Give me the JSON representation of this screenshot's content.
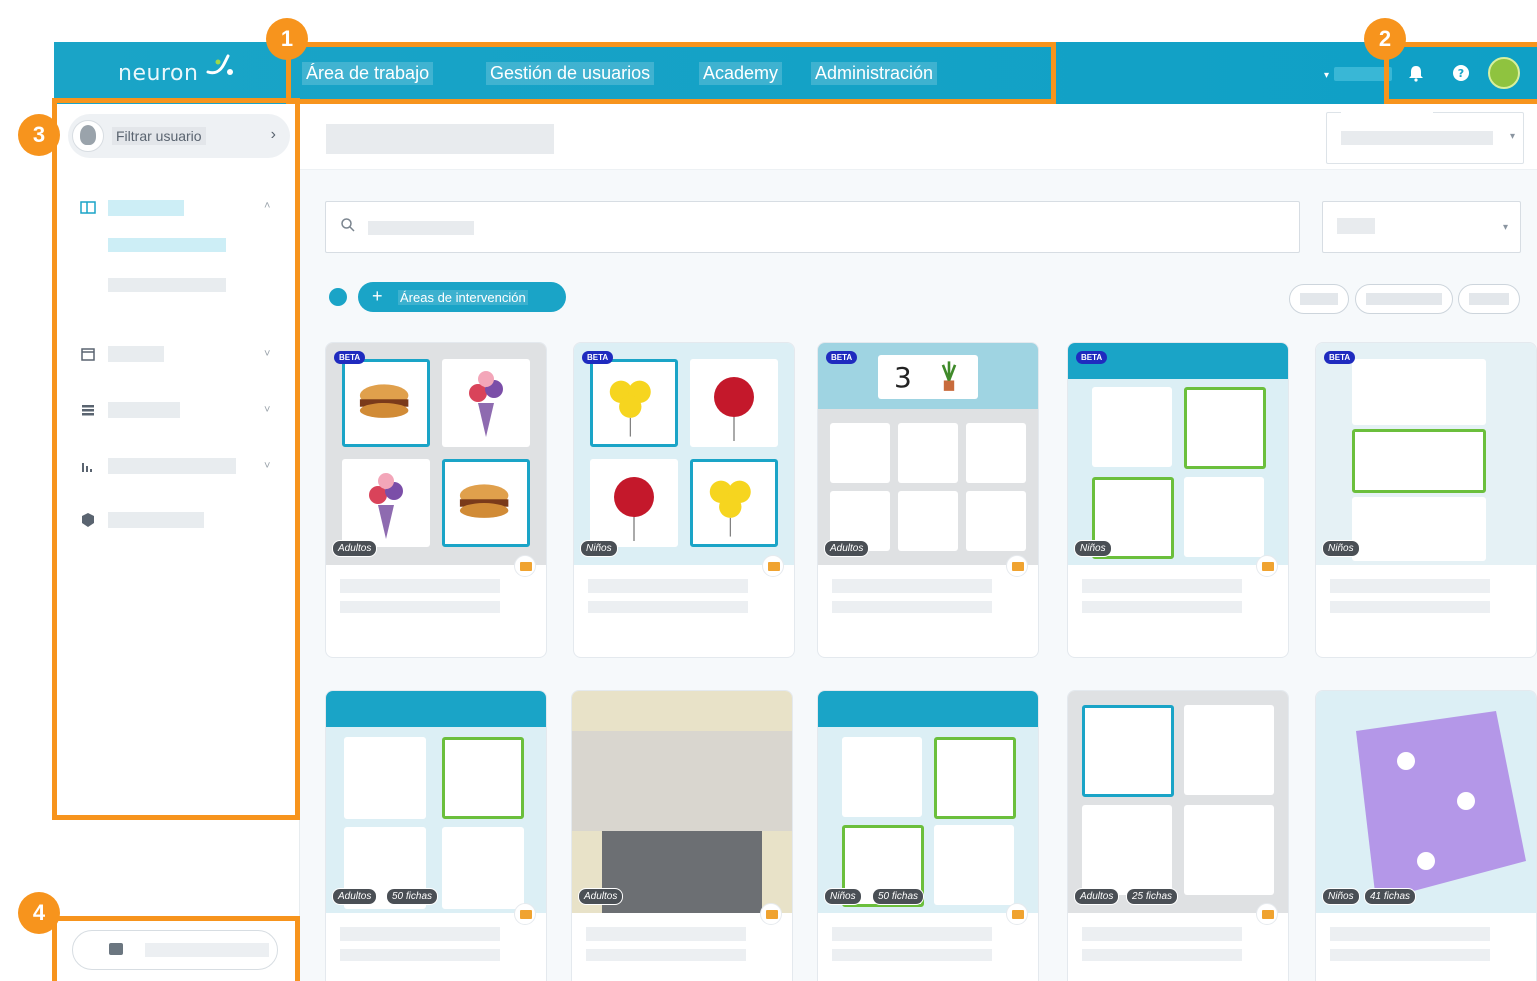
{
  "nav": {
    "items": [
      "Área de trabajo",
      "Gestión de usuarios",
      "Academy",
      "Administración"
    ]
  },
  "sidebar": {
    "user_filter_label": "Filtrar usuario"
  },
  "toolbar": {
    "areas_button": "Áreas de intervención"
  },
  "cards": [
    {
      "beta": "BETA",
      "tag": "Adultos",
      "count": ""
    },
    {
      "beta": "BETA",
      "tag": "Niños",
      "count": ""
    },
    {
      "beta": "BETA",
      "tag": "Adultos",
      "count": "",
      "number": "3"
    },
    {
      "beta": "BETA",
      "tag": "Niños",
      "count": ""
    },
    {
      "beta": "BETA",
      "tag": "Niños",
      "count": ""
    },
    {
      "beta": "",
      "tag": "Adultos",
      "count": "50 fichas"
    },
    {
      "beta": "",
      "tag": "Adultos",
      "count": ""
    },
    {
      "beta": "",
      "tag": "Niños",
      "count": "50 fichas"
    },
    {
      "beta": "",
      "tag": "Adultos",
      "count": "25 fichas"
    },
    {
      "beta": "",
      "tag": "Niños",
      "count": "41 fichas"
    }
  ],
  "badges": [
    "1",
    "2",
    "3",
    "4"
  ],
  "colors": {
    "brand": "#1aa4c7",
    "highlight": "#f7941d",
    "beta": "#1f2bbf"
  }
}
